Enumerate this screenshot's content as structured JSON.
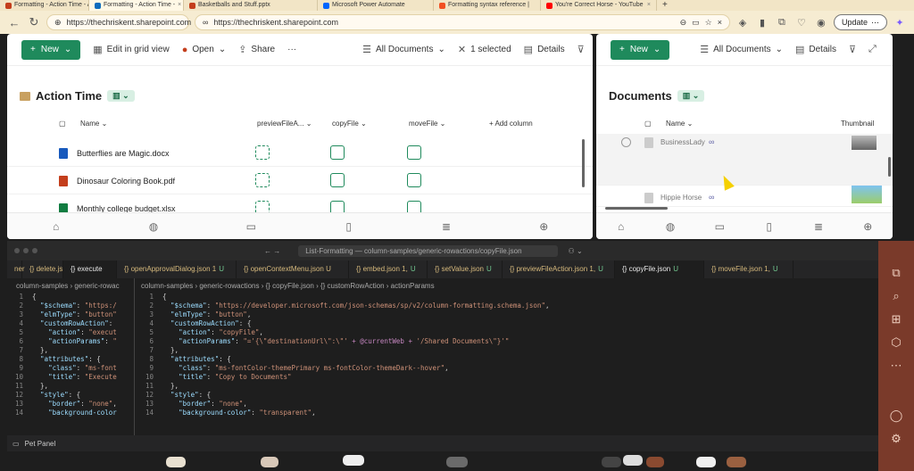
{
  "browser": {
    "tabs": [
      {
        "label": "Formatting - Action Time - All",
        "color": "#0f6cbd",
        "active": false
      },
      {
        "label": "Formatting - Action Time -",
        "color": "#0f6cbd",
        "active": true
      },
      {
        "label": "Basketballs and Stuff.pptx",
        "color": "#c43e1c",
        "active": false
      },
      {
        "label": "Microsoft Power Automate",
        "color": "#0066ff",
        "active": false
      },
      {
        "label": "Formatting syntax reference |",
        "color": "#f25022",
        "active": false
      },
      {
        "label": "You're Correct Horse - YouTube",
        "color": "#ff0000",
        "active": false
      }
    ],
    "address1": "https://thechriskent.sharepoint.com",
    "address2": "https://thechriskent.sharepoint.com",
    "update_label": "Update"
  },
  "left": {
    "new_label": "New",
    "edit_grid": "Edit in grid view",
    "open": "Open",
    "share": "Share",
    "more": "···",
    "view": "All Documents",
    "selected": "1 selected",
    "details": "Details",
    "title": "Action Time",
    "columns": {
      "name": "Name",
      "preview": "previewFileA...",
      "copy": "copyFile",
      "move": "moveFile",
      "add": "+ Add column"
    },
    "files": [
      {
        "name": "Butterflies are Magic.docx",
        "icon_color": "#185abd"
      },
      {
        "name": "Dinosaur Coloring Book.pdf",
        "icon_color": "#c43e1c"
      },
      {
        "name": "Monthly college budget.xlsx",
        "icon_color": "#107c41"
      }
    ]
  },
  "right": {
    "new_label": "New",
    "view": "All Documents",
    "details": "Details",
    "title": "Documents",
    "col_name": "Name",
    "col_thumb": "Thumbnail",
    "items": [
      {
        "name": "BusinessLady"
      },
      {
        "name": "Hippie Horse"
      }
    ]
  },
  "vscode": {
    "title": "List-Formatting — column-samples/generic-rowactions/copyFile.json",
    "tabs": [
      {
        "label": "ner",
        "u": ""
      },
      {
        "label": "{} delete.js",
        "u": ""
      },
      {
        "label": "{} execute",
        "u": ""
      },
      {
        "label": "{} openApprovalDialog.json 1",
        "u": "U"
      },
      {
        "label": "{} openContextMenu.json U",
        "u": ""
      },
      {
        "label": "{} embed.json 1,",
        "u": "U"
      },
      {
        "label": "{} setValue.json",
        "u": "U"
      },
      {
        "label": "{} previewFileAction.json 1,",
        "u": "U"
      },
      {
        "label": "{} copyFile.json",
        "u": "U"
      },
      {
        "label": "{} moveFile.json 1,",
        "u": "U"
      }
    ],
    "crumb_left": "column-samples › generic-rowac",
    "crumb_right": "column-samples › generic-rowactions › {} copyFile.json › {} customRowAction › actionParams",
    "pet_panel": "Pet Panel"
  }
}
